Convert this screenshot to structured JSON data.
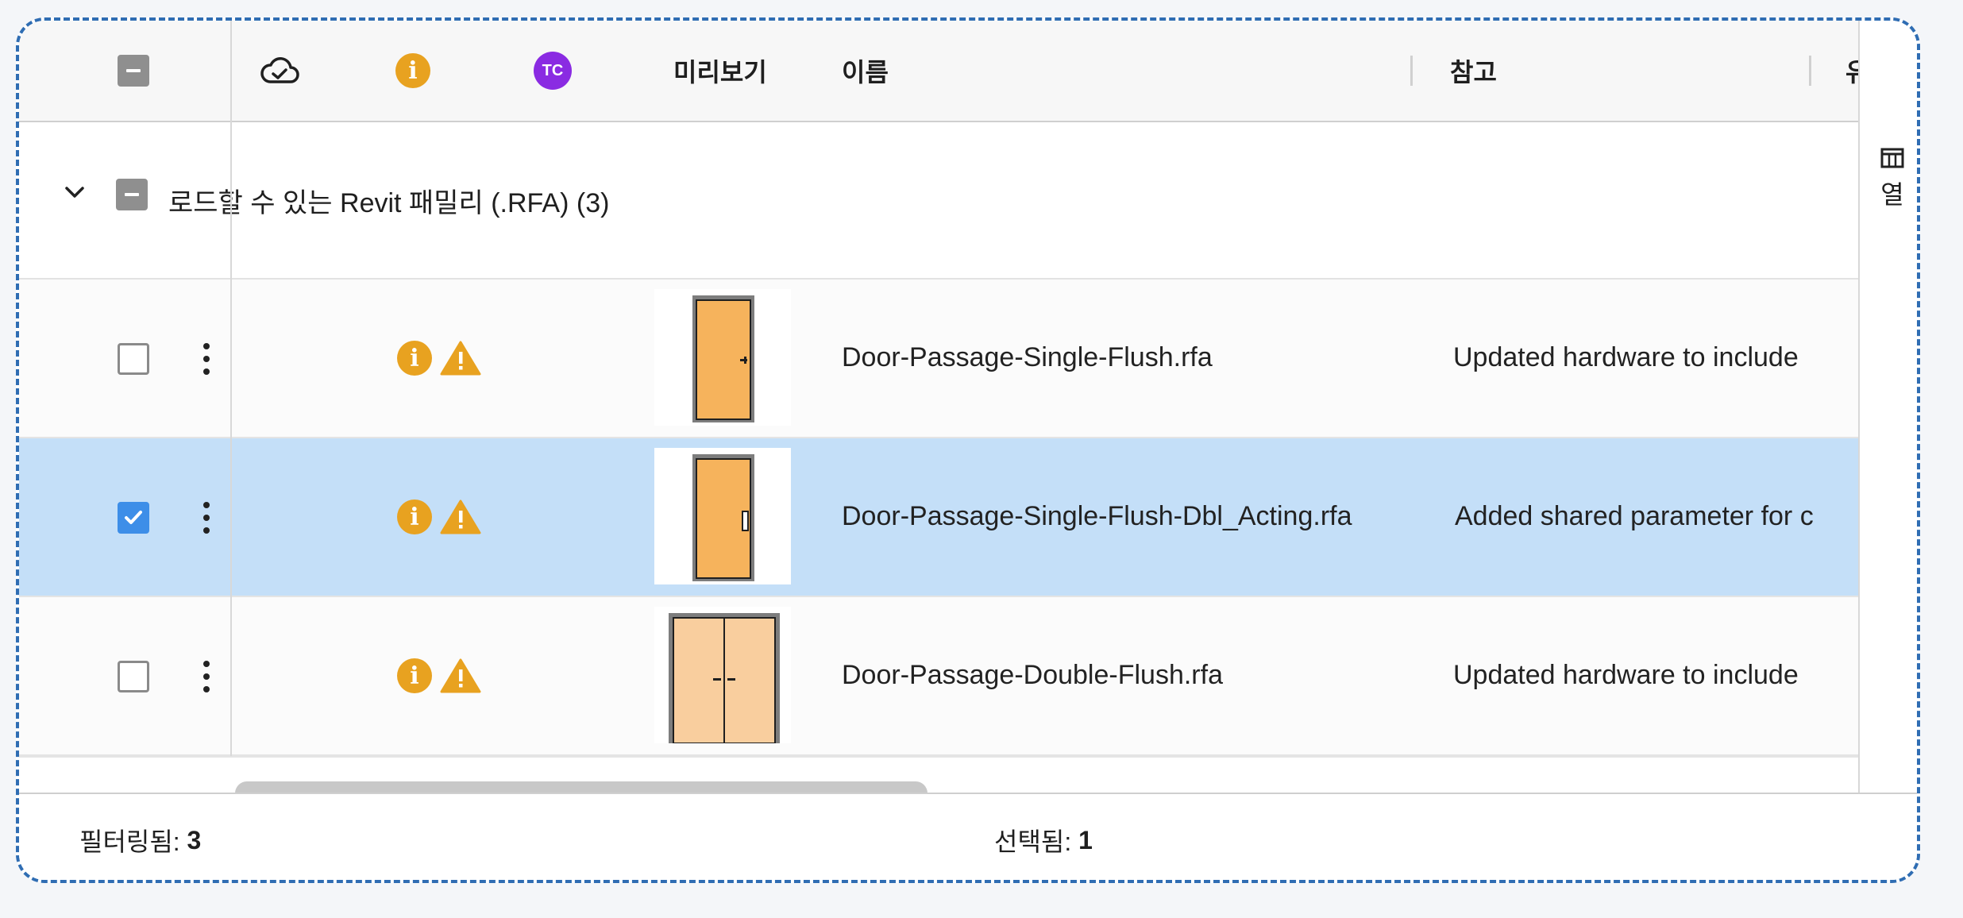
{
  "header": {
    "preview_label": "미리보기",
    "name_label": "이름",
    "notes_label": "참고",
    "cut_label": "유",
    "info_glyph": "i",
    "tc_label": "TC",
    "icons": [
      "cloud-check-icon",
      "info-icon",
      "tc-badge"
    ]
  },
  "group": {
    "label": "로드할 수 있는 Revit 패밀리 (.RFA) (3)"
  },
  "rows": [
    {
      "name": "Door-Passage-Single-Flush.rfa",
      "note": "Updated hardware to include",
      "checked": false,
      "thumb": "single-door"
    },
    {
      "name": "Door-Passage-Single-Flush-Dbl_Acting.rfa",
      "note": "Added shared parameter for c",
      "checked": true,
      "thumb": "single-door-dbl"
    },
    {
      "name": "Door-Passage-Double-Flush.rfa",
      "note": "Updated hardware to include",
      "checked": false,
      "thumb": "double-door"
    }
  ],
  "side_panel": {
    "columns_label": "열"
  },
  "footer": {
    "filtered_label": "필터링됨: ",
    "filtered_count": "3",
    "selected_label": "선택됨: ",
    "selected_count": "1"
  },
  "colors": {
    "accent": "#3d8ee8",
    "selected_row": "#c4dff8",
    "info": "#e8a220",
    "warning": "#e8a220",
    "tc_badge": "#8a2be2",
    "door_fill": "#f6b35c",
    "double_door_fill": "#f9ce9e",
    "border": "#2f6db3"
  }
}
